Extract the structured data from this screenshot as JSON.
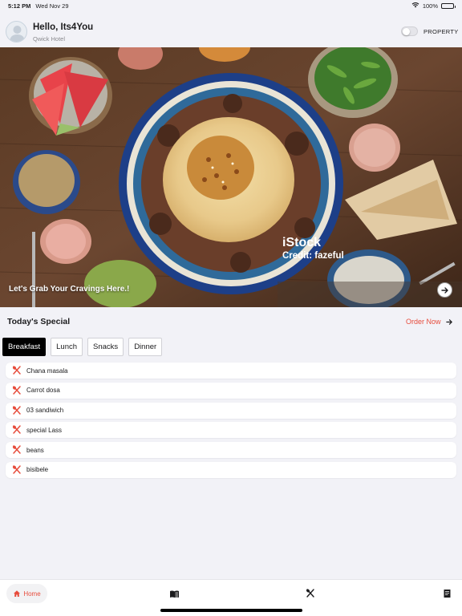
{
  "status_bar": {
    "time": "5:12 PM",
    "date": "Wed Nov 29",
    "battery": "100%",
    "battery_level": 1.0,
    "icons": [
      "wifi-icon",
      "battery-icon"
    ]
  },
  "header": {
    "greeting": "Hello, Its4You",
    "hotel": "Qwick Hotel",
    "toggle_label": "PROPERTY",
    "toggle_on": false
  },
  "hero": {
    "watermark_logo": "iStock",
    "watermark_credit": "Credit: fazeful",
    "tagline": "Let's Grab Your Cravings Here.!",
    "next_icon": "arrow-right-icon"
  },
  "special": {
    "title": "Today's Special",
    "order_now": "Order Now"
  },
  "tabs": [
    {
      "label": "Breakfast",
      "active": true
    },
    {
      "label": "Lunch",
      "active": false
    },
    {
      "label": "Snacks",
      "active": false
    },
    {
      "label": "Dinner",
      "active": false
    }
  ],
  "menu_items": [
    {
      "name": "Chana masala",
      "icon": "fork-knife-icon"
    },
    {
      "name": "Carrot dosa",
      "icon": "fork-knife-icon"
    },
    {
      "name": "03 sandiwich",
      "icon": "fork-knife-icon"
    },
    {
      "name": "special Lass",
      "icon": "fork-knife-icon"
    },
    {
      "name": "beans",
      "icon": "fork-knife-icon"
    },
    {
      "name": "bisibele",
      "icon": "fork-knife-icon"
    }
  ],
  "bottom_nav": {
    "home_label": "Home",
    "items": [
      "home-icon",
      "menu-book-icon",
      "restaurant-icon",
      "receipt-icon"
    ]
  },
  "colors": {
    "accent": "#e74c3c",
    "background": "#f2f2f7",
    "active_tab": "#000000"
  }
}
